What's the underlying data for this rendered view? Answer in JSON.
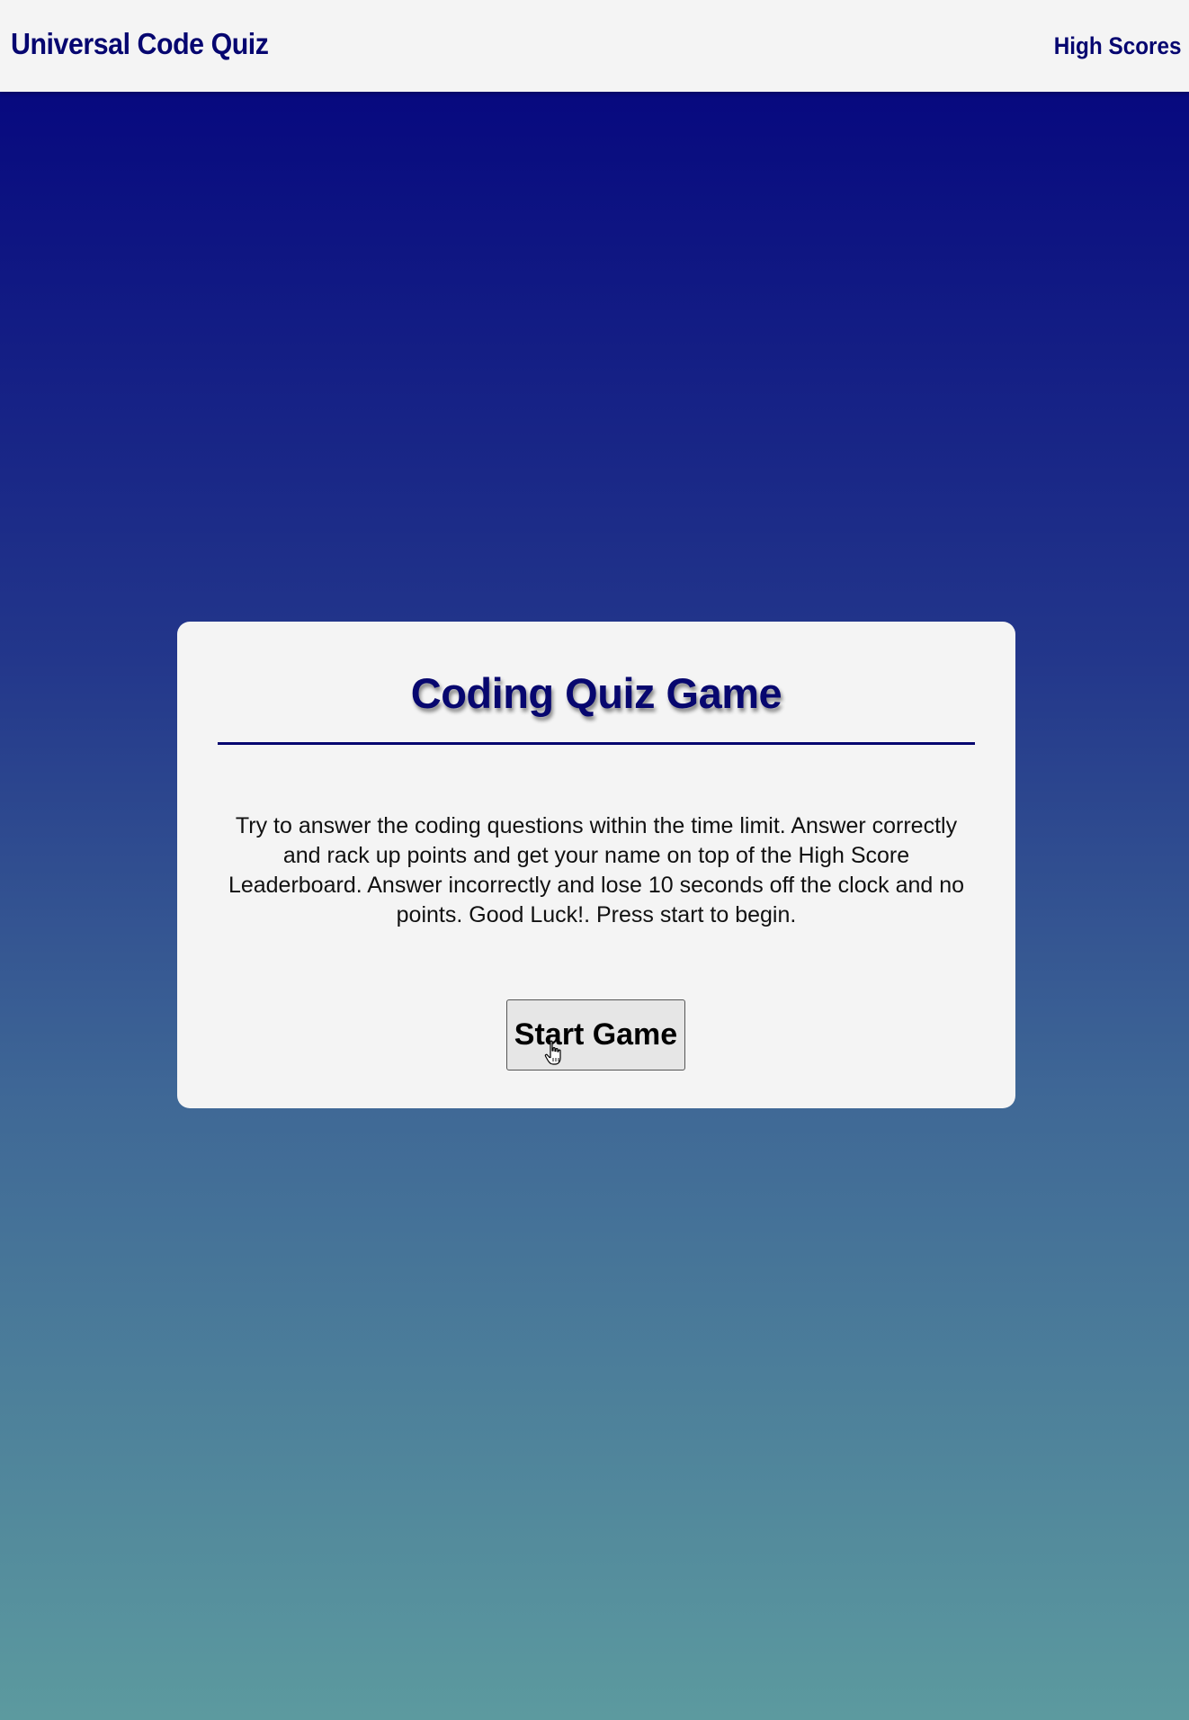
{
  "header": {
    "app_title": "Universal Code Quiz",
    "high_scores_label": "High Scores"
  },
  "card": {
    "title": "Coding Quiz Game",
    "instructions": "Try to answer the coding questions within the time limit. Answer correctly and rack up points and get your name on top of the High Score Leaderboard. Answer incorrectly and lose 10 seconds off the clock and no points. Good Luck!. Press start to begin.",
    "start_button_label": "Start Game"
  },
  "colors": {
    "brand_navy": "#07076f",
    "gradient_top": "#07097f",
    "gradient_bottom": "#5c9a9f",
    "card_background": "#f4f4f4"
  },
  "icons": {
    "cursor": "hand-pointer-icon"
  }
}
